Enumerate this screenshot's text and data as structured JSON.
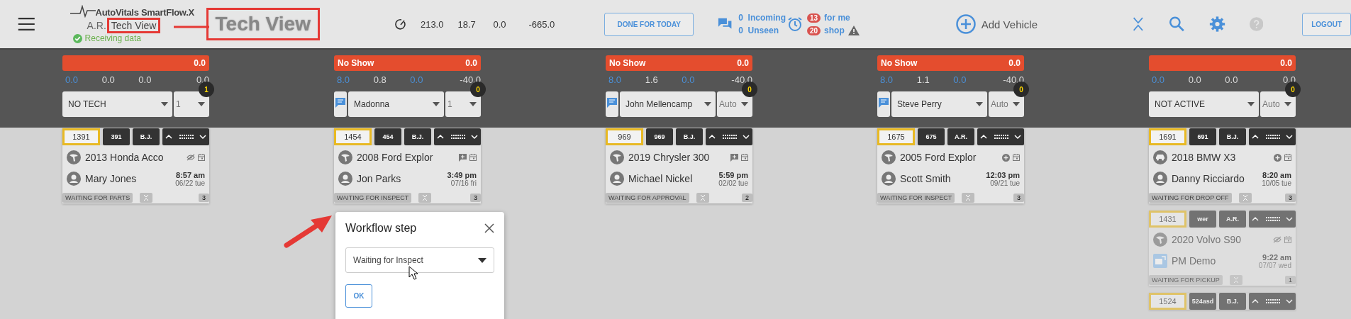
{
  "header": {
    "app_name": "AutoVitals SmartFlow.X",
    "user_initials": "A.R.",
    "view_label": "Tech View",
    "status": "Receiving data",
    "annotation_label": "Tech View",
    "stats": [
      "213.0",
      "18.7",
      "0.0",
      "-665.0"
    ],
    "done_button": "DONE FOR TODAY",
    "messages": {
      "incoming_count": "0",
      "incoming_label": "Incoming",
      "unseen_count": "0",
      "unseen_label": "Unseen"
    },
    "alerts": {
      "for_me_count": "13",
      "for_me_label": "for me",
      "shop_count": "20",
      "shop_label": "shop"
    },
    "add_vehicle": "Add Vehicle",
    "logout": "LOGOUT"
  },
  "columns": [
    {
      "total": "0.0",
      "metrics": [
        {
          "value": "0.0",
          "highlighted": true
        },
        {
          "value": "0.0",
          "highlighted": false
        },
        {
          "value": "0.0",
          "highlighted": false
        },
        {
          "value": "0.0",
          "highlighted": false
        }
      ],
      "chat": false,
      "tech": "NO TECH",
      "slot": "1",
      "badge": "1",
      "cards": [
        {
          "ro": "1391",
          "tag": "391",
          "tech": "B.J.",
          "vehicle": {
            "kind": "service",
            "name": "2013 Honda Acco"
          },
          "flag": {
            "kind": "hidden"
          },
          "customer": {
            "kind": "person",
            "name": "Mary Jones"
          },
          "time": "8:57 am",
          "date": "06/22 tue",
          "status": "WAITING FOR PARTS",
          "count": "3",
          "dimmed": false
        }
      ]
    },
    {
      "status_label": "No Show",
      "total": "0.0",
      "metrics": [
        {
          "value": "8.0",
          "highlighted": true
        },
        {
          "value": "0.8",
          "highlighted": false
        },
        {
          "value": "0.0",
          "highlighted": true
        },
        {
          "value": "-40.0",
          "highlighted": false
        }
      ],
      "chat": true,
      "tech": "Madonna",
      "slot": "1",
      "badge": "0",
      "cards": [
        {
          "ro": "1454",
          "tag": "454",
          "tech": "B.J.",
          "vehicle": {
            "kind": "service",
            "name": "2008 Ford Explor"
          },
          "flag": {
            "kind": "note"
          },
          "customer": {
            "kind": "person",
            "name": "Jon Parks"
          },
          "time": "3:49 pm",
          "date": "07/16 fri",
          "status": "WAITING FOR INSPECT",
          "count": "3",
          "dimmed": false
        }
      ]
    },
    {
      "status_label": "No Show",
      "total": "0.0",
      "metrics": [
        {
          "value": "8.0",
          "highlighted": true
        },
        {
          "value": "1.6",
          "highlighted": false
        },
        {
          "value": "0.0",
          "highlighted": true
        },
        {
          "value": "-40.0",
          "highlighted": false
        }
      ],
      "chat": true,
      "tech": "John Mellencamp",
      "slot": "Auto",
      "badge": "0",
      "cards": [
        {
          "ro": "969",
          "tag": "969",
          "tech": "B.J.",
          "vehicle": {
            "kind": "service",
            "name": "2019 Chrysler 300"
          },
          "flag": {
            "kind": "note"
          },
          "customer": {
            "kind": "person",
            "name": "Michael Nickel"
          },
          "time": "5:59 pm",
          "date": "02/02 tue",
          "status": "WAITING FOR APPROVAL",
          "count": "2",
          "dimmed": false
        }
      ]
    },
    {
      "status_label": "No Show",
      "total": "0.0",
      "metrics": [
        {
          "value": "8.0",
          "highlighted": true
        },
        {
          "value": "1.1",
          "highlighted": false
        },
        {
          "value": "0.0",
          "highlighted": true
        },
        {
          "value": "-40.0",
          "highlighted": false
        }
      ],
      "chat": true,
      "tech": "Steve Perry",
      "slot": "Auto",
      "badge": "0",
      "cards": [
        {
          "ro": "1675",
          "tag": "675",
          "tech": "A.R.",
          "vehicle": {
            "kind": "service",
            "name": "2005 Ford Explor"
          },
          "flag": {
            "kind": "added"
          },
          "customer": {
            "kind": "person",
            "name": "Scott Smith"
          },
          "time": "12:03 pm",
          "date": "09/21 tue",
          "status": "WAITING FOR INSPECT",
          "count": "3",
          "dimmed": false
        }
      ]
    },
    {
      "total": "0.0",
      "metrics": [
        {
          "value": "0.0",
          "highlighted": true
        },
        {
          "value": "0.0",
          "highlighted": false
        },
        {
          "value": "0.0",
          "highlighted": false
        },
        {
          "value": "0.0",
          "highlighted": false
        }
      ],
      "chat": false,
      "tech": "NOT ACTIVE",
      "slot": "Auto",
      "badge": "0",
      "cards": [
        {
          "ro": "1691",
          "tag": "691",
          "tech": "B.J.",
          "vehicle": {
            "kind": "car",
            "name": "2018 BMW X3"
          },
          "flag": {
            "kind": "added"
          },
          "customer": {
            "kind": "person",
            "name": "Danny Ricciardo"
          },
          "time": "8:20 am",
          "date": "10/05 tue",
          "status": "WAITING FOR DROP OFF",
          "count": "3",
          "dimmed": false
        },
        {
          "ro": "1431",
          "tag": "wer",
          "tech": "A.R.",
          "vehicle": {
            "kind": "service",
            "name": "2020 Volvo S90"
          },
          "flag": {
            "kind": "hidden"
          },
          "customer": {
            "kind": "fleet",
            "name": "PM Demo"
          },
          "time": "9:22 am",
          "date": "07/07 wed",
          "status": "WAITING FOR PICKUP",
          "count": "1",
          "dimmed": true
        },
        {
          "ro": "1524",
          "tag": "524asd",
          "tech": "B.J.",
          "dimmed": true
        }
      ]
    }
  ],
  "dialog": {
    "title": "Workflow step",
    "value": "Waiting for Inspect",
    "ok": "OK"
  }
}
